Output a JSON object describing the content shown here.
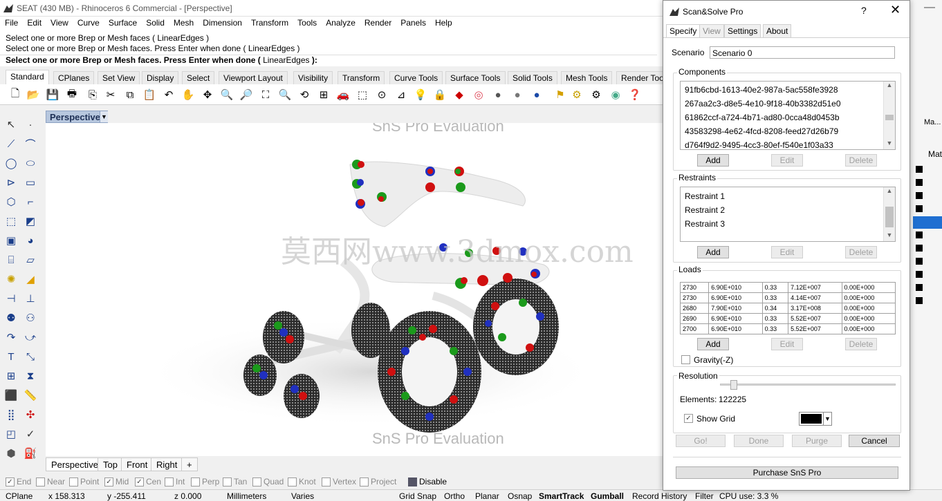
{
  "window": {
    "title": "SEAT (430 MB) - Rhinoceros 6 Commercial - [Perspective]"
  },
  "menu": [
    "File",
    "Edit",
    "View",
    "Curve",
    "Surface",
    "Solid",
    "Mesh",
    "Dimension",
    "Transform",
    "Tools",
    "Analyze",
    "Render",
    "Panels",
    "Help"
  ],
  "command": {
    "history1": "Select one or more Brep or Mesh faces ( LinearEdges )",
    "history2": "Select one or more Brep or Mesh faces. Press Enter when done ( LinearEdges )",
    "prompt_prefix": "Select one or more Brep or Mesh faces. Press Enter when done (",
    "prompt_option": "LinearEdges",
    "prompt_suffix": "):"
  },
  "toolbar_tabs": [
    "Standard",
    "CPlanes",
    "Set View",
    "Display",
    "Select",
    "Viewport Layout",
    "Visibility",
    "Transform",
    "Curve Tools",
    "Surface Tools",
    "Solid Tools",
    "Mesh Tools",
    "Render Too"
  ],
  "viewport": {
    "title": "Perspective",
    "eval_top": "SnS Pro Evaluation",
    "eval_bottom": "SnS Pro Evaluation",
    "watermark": "莫西网www.3dmox.com"
  },
  "viewport_tabs": [
    "Perspective",
    "Top",
    "Front",
    "Right",
    "+"
  ],
  "osnap": [
    {
      "label": "End",
      "checked": true
    },
    {
      "label": "Near",
      "checked": false
    },
    {
      "label": "Point",
      "checked": false
    },
    {
      "label": "Mid",
      "checked": true
    },
    {
      "label": "Cen",
      "checked": true
    },
    {
      "label": "Int",
      "checked": false
    },
    {
      "label": "Perp",
      "checked": false
    },
    {
      "label": "Tan",
      "checked": false
    },
    {
      "label": "Quad",
      "checked": false
    },
    {
      "label": "Knot",
      "checked": false
    },
    {
      "label": "Vertex",
      "checked": false
    },
    {
      "label": "Project",
      "checked": false
    },
    {
      "label": "Disable",
      "checked": false
    }
  ],
  "status": {
    "cplane": "CPlane",
    "x": "x 158.313",
    "y": "y -255.411",
    "z": "z 0.000",
    "units": "Millimeters",
    "layer": "Varies",
    "grid_snap": "Grid Snap",
    "ortho": "Ortho",
    "planar": "Planar",
    "osnap": "Osnap",
    "smarttrack": "SmartTrack",
    "gumball": "Gumball",
    "record": "Record History",
    "filter": "Filter",
    "cpu": "CPU use: 3.3 %"
  },
  "dialog": {
    "title": "Scan&Solve Pro",
    "help": "?",
    "close": "✕",
    "tabs": [
      "Specify",
      "View",
      "Settings",
      "About"
    ],
    "scenario_label": "Scenario",
    "scenario_value": "Scenario 0",
    "components_label": "Components",
    "components": [
      "91fb6cbd-1613-40e2-987a-5ac558fe3928",
      "267aa2c3-d8e5-4e10-9f18-40b3382d51e0",
      "61862ccf-a724-4b71-ad80-0cca48d0453b",
      "43583298-4e62-4fcd-8208-feed27d26b79",
      "d764f9d2-9495-4cc3-80ef-f540e1f03a33"
    ],
    "restraints_label": "Restraints",
    "restraints": [
      "Restraint 1",
      "Restraint 2",
      "Restraint 3"
    ],
    "loads_label": "Loads",
    "loads": [
      [
        "2730",
        "6.90E+010",
        "0.33",
        "7.12E+007",
        "0.00E+000"
      ],
      [
        "2730",
        "6.90E+010",
        "0.33",
        "4.14E+007",
        "0.00E+000"
      ],
      [
        "2680",
        "7.90E+010",
        "0.34",
        "3.17E+008",
        "0.00E+000"
      ],
      [
        "2690",
        "6.90E+010",
        "0.33",
        "5.52E+007",
        "0.00E+000"
      ],
      [
        "2700",
        "6.90E+010",
        "0.33",
        "5.52E+007",
        "0.00E+000"
      ]
    ],
    "add": "Add",
    "edit": "Edit",
    "delete": "Delete",
    "gravity_label": "Gravity(-Z)",
    "resolution_label": "Resolution",
    "resolution_fraction": 0.25,
    "elements_label": "Elements:",
    "elements_value": "122225",
    "show_grid_label": "Show Grid",
    "grid_color": "#000000",
    "go": "Go!",
    "done": "Done",
    "purge": "Purge",
    "cancel": "Cancel",
    "purchase": "Purchase SnS Pro"
  },
  "right_panel": {
    "tab": "Ma...",
    "column": "Mat"
  }
}
